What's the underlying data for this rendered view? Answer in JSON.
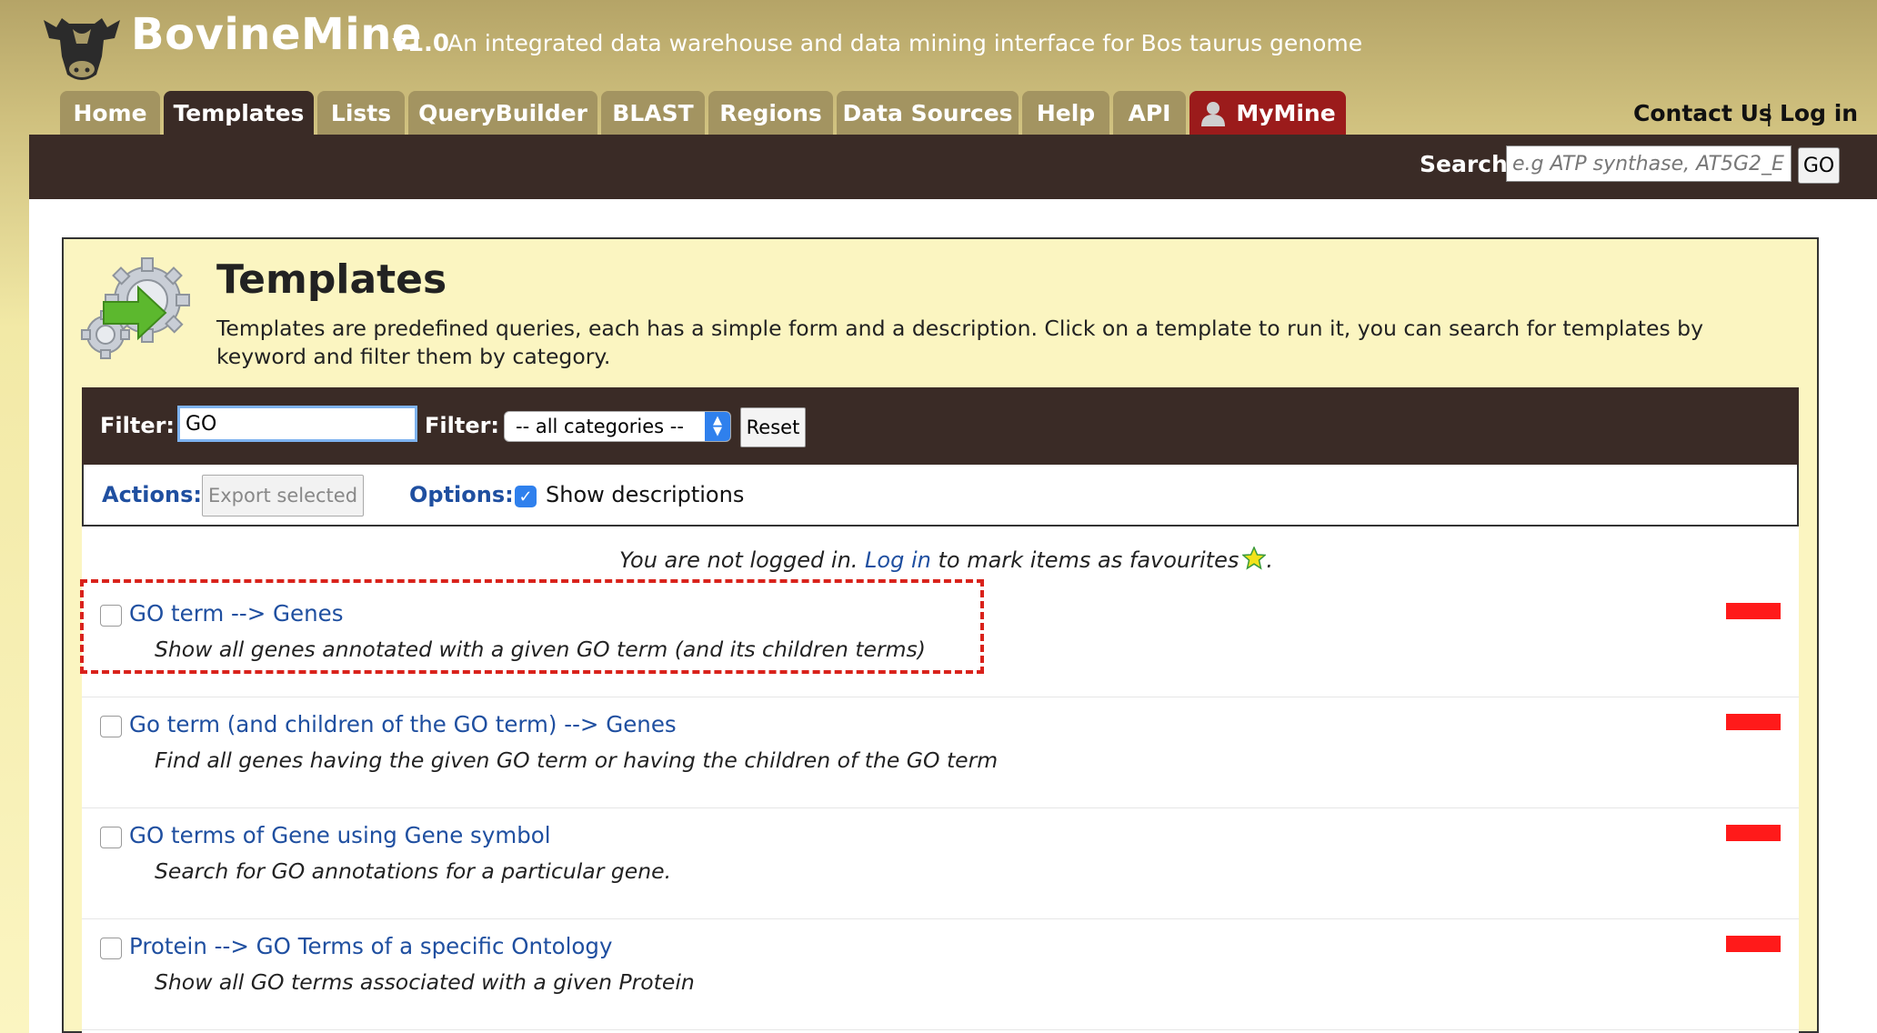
{
  "header": {
    "brand": "BovineMine",
    "version": "v1.0",
    "tagline": "An integrated data warehouse and data mining interface for Bos taurus genome",
    "logo_icon": "cow-head-icon"
  },
  "tabs": [
    {
      "label": "Home"
    },
    {
      "label": "Templates"
    },
    {
      "label": "Lists"
    },
    {
      "label": "QueryBuilder"
    },
    {
      "label": "BLAST"
    },
    {
      "label": "Regions"
    },
    {
      "label": "Data Sources"
    },
    {
      "label": "Help"
    },
    {
      "label": "API"
    },
    {
      "label": "MyMine",
      "icon": "user-icon"
    }
  ],
  "active_tab": "Templates",
  "top_links": {
    "contact": "Contact Us",
    "separator": "|",
    "login": "Log in"
  },
  "search": {
    "label": "Search:",
    "placeholder": "e.g ATP synthase, AT5G2_E",
    "button": "GO"
  },
  "page": {
    "title": "Templates",
    "description": "Templates are predefined queries, each has a simple form and a description. Click on a template to run it, you can search for templates by keyword and filter them by category.",
    "icon": "gear-arrow-icon"
  },
  "filter": {
    "label1": "Filter:",
    "value": "GO",
    "label2": "Filter:",
    "category": "-- all categories --",
    "reset": "Reset"
  },
  "actions": {
    "label": "Actions:",
    "export": "Export selected",
    "options_label": "Options:",
    "show_descriptions": "Show descriptions",
    "show_descriptions_checked": true
  },
  "login_notice": {
    "prefix": "You are not logged in.",
    "link": "Log in",
    "suffix": "to mark items as favourites",
    "end": "."
  },
  "templates": [
    {
      "title": "GO term --> Genes",
      "description": "Show all genes annotated with a given GO term (and its children terms)",
      "highlighted": true
    },
    {
      "title": "Go term (and children of the GO term) --> Genes",
      "description": "Find all genes having the given GO term or having the children of the GO term"
    },
    {
      "title": "GO terms of Gene using Gene symbol",
      "description": "Search for GO annotations for a particular gene."
    },
    {
      "title": "Protein --> GO Terms of a specific Ontology",
      "description": "Show all GO terms associated with a given Protein"
    }
  ],
  "colors": {
    "dark_bar": "#3a2b26",
    "tab": "#a39461",
    "mymine_tab": "#9b1b1b",
    "link": "#1f4fa0",
    "tag": "#ff1a1a",
    "highlight": "#d9221b"
  }
}
